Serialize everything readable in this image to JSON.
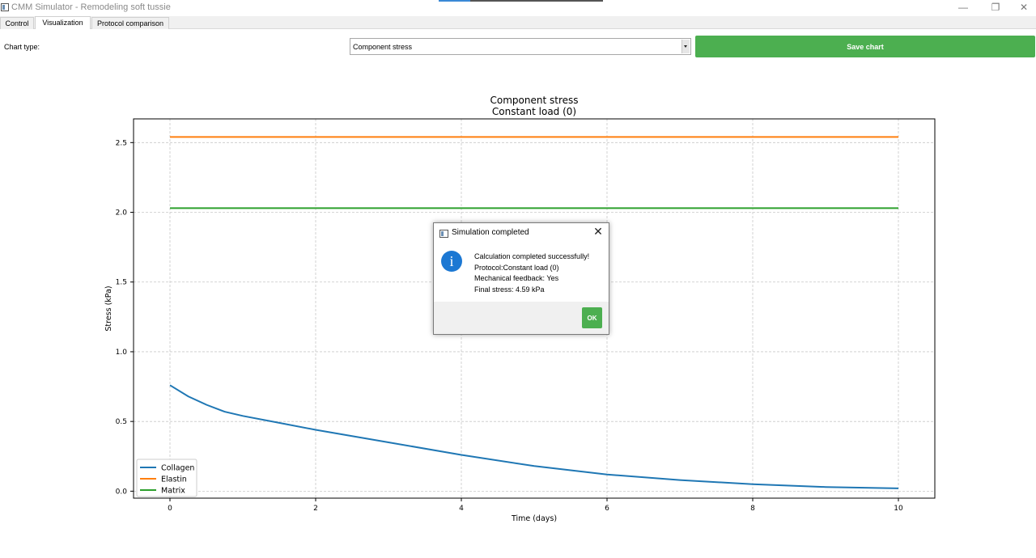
{
  "window": {
    "title": "CMM Simulator - Remodeling soft tussie",
    "controls": {
      "minimize": "—",
      "maximize": "❐",
      "close": "✕"
    },
    "progress_fraction": 0.19
  },
  "tabs": [
    {
      "label": "Control",
      "active": false
    },
    {
      "label": "Visualization",
      "active": true
    },
    {
      "label": "Protocol comparison",
      "active": false
    }
  ],
  "toolbar": {
    "chart_type_label": "Chart type:",
    "chart_type_value": "Component stress",
    "save_label": "Save chart",
    "save_color": "#4caf50"
  },
  "chart_data": {
    "type": "line",
    "title": "Component stress",
    "subtitle": "Constant load (0)",
    "xlabel": "Time (days)",
    "ylabel": "Stress (kPa)",
    "xlim": [
      -0.5,
      10.5
    ],
    "ylim": [
      -0.05,
      2.67
    ],
    "xticks": [
      0,
      2,
      4,
      6,
      8,
      10
    ],
    "yticks": [
      0.0,
      0.5,
      1.0,
      1.5,
      2.0,
      2.5
    ],
    "grid": true,
    "legend_position": "lower-left",
    "series": [
      {
        "name": "Collagen",
        "color": "#1f77b4",
        "x": [
          0,
          0.25,
          0.5,
          0.75,
          1,
          1.5,
          2,
          3,
          4,
          5,
          6,
          7,
          8,
          9,
          10
        ],
        "y": [
          0.76,
          0.68,
          0.62,
          0.57,
          0.54,
          0.49,
          0.44,
          0.35,
          0.26,
          0.18,
          0.12,
          0.08,
          0.05,
          0.03,
          0.02
        ]
      },
      {
        "name": "Elastin",
        "color": "#ff7f0e",
        "x": [
          0,
          10
        ],
        "y": [
          2.54,
          2.54
        ]
      },
      {
        "name": "Matrix",
        "color": "#2ca02c",
        "x": [
          0,
          10
        ],
        "y": [
          2.03,
          2.03
        ]
      }
    ]
  },
  "dialog": {
    "title": "Simulation completed",
    "close_label": "✕",
    "info_icon": "i",
    "lines": [
      "Calculation completed successfully!",
      "Protocol:Constant load (0)",
      "Mechanical feedback: Yes",
      "Final stress: 4.59 kPa"
    ],
    "ok_label": "OK"
  }
}
